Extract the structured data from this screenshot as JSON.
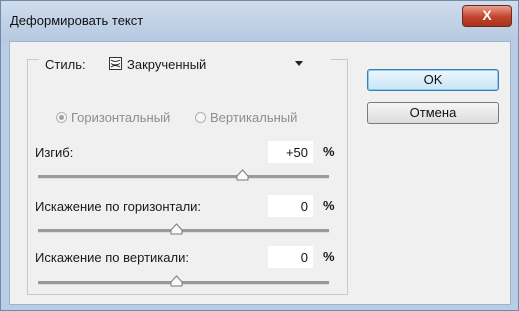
{
  "window": {
    "title": "Деформировать текст",
    "close_glyph": "X"
  },
  "style": {
    "label": "Стиль:",
    "value": "Закрученный",
    "icon": "warp-twist-icon"
  },
  "orientation": {
    "horizontal": "Горизонтальный",
    "vertical": "Вертикальный",
    "selected": "horizontal"
  },
  "bend": {
    "label": "Изгиб:",
    "value": "+50",
    "unit": "%",
    "level": 50
  },
  "hdist": {
    "label": "Искажение по горизонтали:",
    "value": "0",
    "unit": "%",
    "level": 0
  },
  "vdist": {
    "label": "Искажение по вертикали:",
    "value": "0",
    "unit": "%",
    "level": 0
  },
  "buttons": {
    "ok": "OK",
    "cancel": "Отмена"
  }
}
